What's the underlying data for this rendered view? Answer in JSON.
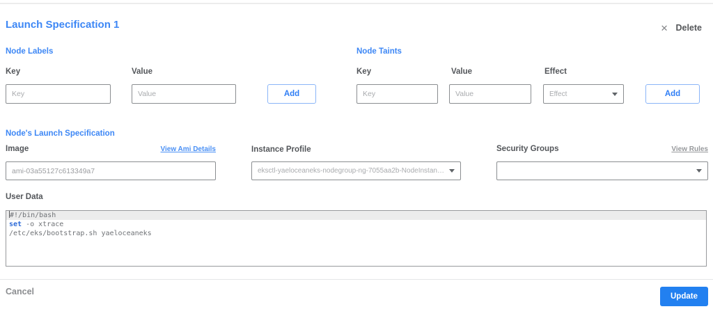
{
  "header": {
    "title": "Launch Specification 1",
    "delete_label": "Delete",
    "delete_icon": "✕"
  },
  "node_labels": {
    "section_title": "Node Labels",
    "key_label": "Key",
    "key_placeholder": "Key",
    "value_label": "Value",
    "value_placeholder": "Value",
    "add_label": "Add"
  },
  "node_taints": {
    "section_title": "Node Taints",
    "key_label": "Key",
    "key_placeholder": "Key",
    "value_label": "Value",
    "value_placeholder": "Value",
    "effect_label": "Effect",
    "effect_placeholder": "Effect",
    "add_label": "Add"
  },
  "launch_spec": {
    "section_title": "Node's Launch Specification",
    "image_label": "Image",
    "view_ami_link": "View Ami Details",
    "image_value": "ami-03a55127c613349a7",
    "instance_profile_label": "Instance Profile",
    "instance_profile_value": "eksctl-yaeloceaneks-nodegroup-ng-7055aa2b-NodeInstanceProfile-...",
    "security_groups_label": "Security Groups",
    "view_rules_link": "View Rules",
    "security_groups_value": ""
  },
  "user_data": {
    "label": "User Data",
    "lines": [
      {
        "highlight": true,
        "cursor": true,
        "segments": [
          {
            "text": "#!/bin/bash",
            "cls": "code-plain"
          }
        ]
      },
      {
        "highlight": false,
        "cursor": false,
        "segments": [
          {
            "text": "set",
            "cls": "code-keyword"
          },
          {
            "text": " -o xtrace",
            "cls": "code-plain"
          }
        ]
      },
      {
        "highlight": false,
        "cursor": false,
        "segments": [
          {
            "text": "/etc/eks/bootstrap.sh yaeloceaneks",
            "cls": "code-plain"
          }
        ]
      }
    ]
  },
  "footer": {
    "cancel_label": "Cancel",
    "update_label": "Update"
  },
  "colors": {
    "accent_blue": "#3d87f5",
    "button_blue": "#2280f0",
    "label_gray": "#53565a",
    "placeholder_gray": "#a9abae"
  }
}
